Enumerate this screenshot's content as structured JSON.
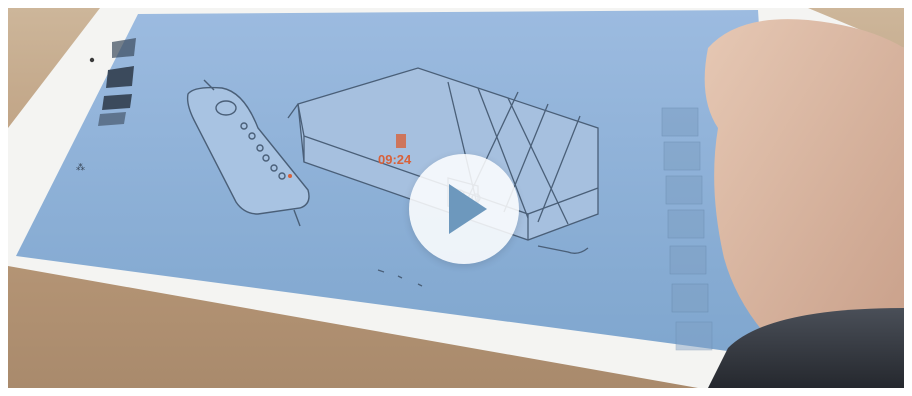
{
  "video": {
    "play_label": ""
  },
  "sketch": {
    "timer": "09:24"
  },
  "colors": {
    "screen": "#8fb2d6",
    "bezel": "#f4f4f2",
    "ink": "#4a5f78",
    "accent": "#d8613a",
    "play_button_bg": "#ffffff",
    "play_icon": "#6d98bd"
  },
  "icons": {
    "play": "play-icon"
  }
}
